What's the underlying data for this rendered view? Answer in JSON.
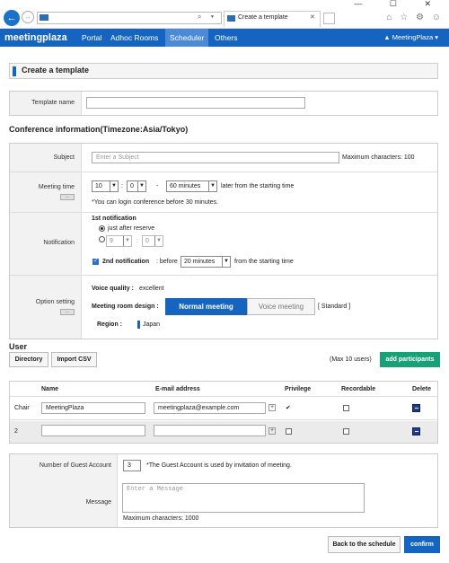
{
  "browser": {
    "window_controls": "— ☐ ✕",
    "tab_title": "Create a template",
    "address_icons": "⌕ ▾ ↻",
    "right_icons": "⌂ ☆ ⚙ ☺"
  },
  "nav": {
    "logo": "meetingplaza",
    "items": [
      "Portal",
      "Adhoc Rooms",
      "Scheduler",
      "Others"
    ],
    "active": "Scheduler",
    "user": "▲ MeetingPlaza ▾"
  },
  "page": {
    "title": "Create a template",
    "template_name_label": "Template name",
    "conference_heading": "Conference information(Timezone:Asia/Tokyo)",
    "subject_label": "Subject",
    "subject_placeholder": "Enter a Subject",
    "subject_max": "Maximum characters: 100",
    "meeting_time_label": "Meeting time",
    "meeting_hour": "10",
    "meeting_minute": "0",
    "meeting_duration": "60 minutes",
    "meeting_colon": ":",
    "meeting_dash": "-",
    "later_text": "later from the starting time",
    "login_note": "*You can login conference before 30 minutes.",
    "small_btn": "...",
    "notification_label": "Notification",
    "first_notification": "1st notification",
    "just_after_reserve": "just after reserve",
    "notif_hour": "9",
    "notif_minute": "0",
    "second_notification": "2nd notification",
    "before_text": ": before",
    "second_minutes": "20 minutes",
    "from_start": "from the starting time",
    "option_label": "Option setting",
    "voice_quality_label": "Voice quality :",
    "voice_quality_value": "excellent",
    "room_design_label": "Meeting room design :",
    "normal_meeting": "Normal meeting",
    "voice_meeting": "Voice meeting",
    "standard": "[ Standard ]",
    "region_label": "Region :",
    "region_value": "Japan"
  },
  "user": {
    "heading": "User",
    "directory_btn": "Directory",
    "import_btn": "Import CSV",
    "max_users": "(Max 10 users)",
    "add_btn": "add participants",
    "columns": [
      "Name",
      "E-mail address",
      "Privilege",
      "Recordable",
      "Delete"
    ],
    "rows": [
      {
        "role": "Chair",
        "name": "MeetingPlaza",
        "email": "meetingplaza@example.com",
        "privilege": "✔"
      },
      {
        "role": "2",
        "name": "",
        "email": "",
        "privilege": ""
      }
    ]
  },
  "guest": {
    "label": "Number of Guest Account",
    "count": "3",
    "note": "*The Guest Account is used by invitation of meeting.",
    "message_label": "Message",
    "message_placeholder": "Enter a Message",
    "message_max": "Maximum characters: 1000"
  },
  "footer": {
    "back_btn": "Back to the schedule",
    "confirm_btn": "confirm"
  }
}
